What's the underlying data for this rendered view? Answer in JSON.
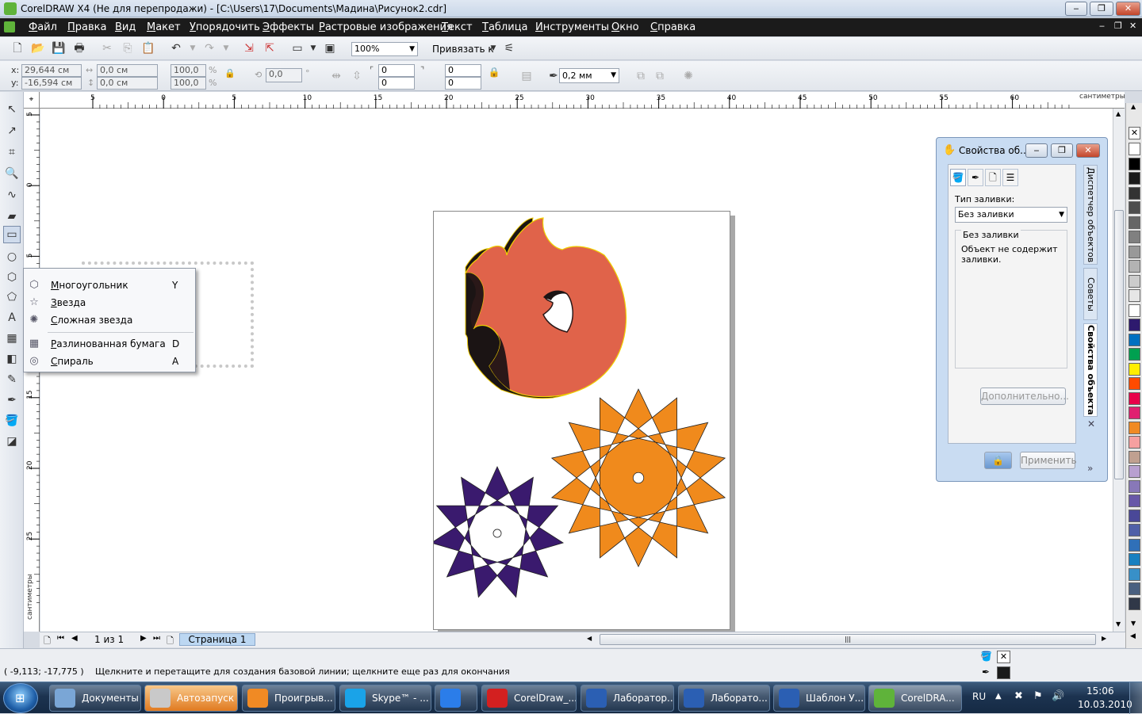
{
  "window": {
    "title": "CorelDRAW X4 (Не для перепродажи) - [C:\\Users\\17\\Documents\\Мадина\\Рисунок2.cdr]",
    "controls": {
      "minimize": "‒",
      "restore": "❐",
      "close": "✕"
    }
  },
  "menu": [
    "Файл",
    "Правка",
    "Вид",
    "Макет",
    "Упорядочить",
    "Эффекты",
    "Растровые изображения",
    "Текст",
    "Таблица",
    "Инструменты",
    "Окно",
    "Справка"
  ],
  "toolbar": {
    "zoom": "100%",
    "snap_label": "Привязать к"
  },
  "property_bar": {
    "x": "29,644 см",
    "y": "-16,594 см",
    "x_label": "x:",
    "y_label": "y:",
    "width": "0,0 см",
    "height": "0,0 см",
    "scale_x": "100,0",
    "scale_y": "100,0",
    "pct": "%",
    "angle": "0,0",
    "corner_tl": "0",
    "corner_bl": "0",
    "corner_tr": "0",
    "corner_br": "0",
    "outline_width": "0,2 мм"
  },
  "ruler": {
    "h_ticks": [
      "5",
      "0",
      "5",
      "10",
      "15",
      "20",
      "25",
      "30",
      "35",
      "40",
      "45",
      "50",
      "55",
      "60"
    ],
    "h_unit": "сантиметры",
    "v_ticks": [
      "5",
      "0",
      "5",
      "10",
      "15",
      "20",
      "25"
    ],
    "v_unit": "сантиметры"
  },
  "flyout": {
    "items": [
      {
        "label": "Многоугольник",
        "key": "Y",
        "icon": "polygon-icon"
      },
      {
        "label": "Звезда",
        "key": "",
        "icon": "star-icon"
      },
      {
        "label": "Сложная звезда",
        "key": "",
        "icon": "complex-star-icon"
      },
      {
        "label": "Разлинованная бумага",
        "key": "D",
        "icon": "graph-paper-icon"
      },
      {
        "label": "Спираль",
        "key": "A",
        "icon": "spiral-icon"
      }
    ]
  },
  "docker": {
    "title": "Свойства об...",
    "fill_type_label": "Тип заливки:",
    "fill_type_value": "Без заливки",
    "group_title": "Без заливки",
    "group_text": "Объект не содержит заливки.",
    "advanced_button": "Дополнительно...",
    "apply_button": "Применить",
    "side_tabs": [
      "Диспетчер объектов",
      "Советы",
      "Свойства объекта"
    ]
  },
  "pages": {
    "counter": "1 из 1",
    "tab": "Страница 1"
  },
  "status": {
    "coords": "( -9,113; -17,775 )",
    "hint": "Щелкните и перетащите для создания базовой линии; щелкните еще раз для окончания"
  },
  "taskbar": {
    "buttons": [
      {
        "label": "Документы",
        "icon": "folder-icon",
        "color": "#7aa6d6"
      },
      {
        "label": "Автозапуск",
        "icon": "drive-icon",
        "color": "#c9c9c9"
      },
      {
        "label": "Проигрыв...",
        "icon": "media-player-icon",
        "color": "#f08a24"
      },
      {
        "label": "Skype™ - ...",
        "icon": "skype-icon",
        "color": "#1aa3e8"
      },
      {
        "label": "",
        "icon": "ie-icon",
        "color": "#2b7de9"
      },
      {
        "label": "CorelDraw_...",
        "icon": "pdf-icon",
        "color": "#d32020"
      },
      {
        "label": "Лаборатор...",
        "icon": "word-icon",
        "color": "#2b5fb3"
      },
      {
        "label": "Лаборато...",
        "icon": "word-icon",
        "color": "#2b5fb3"
      },
      {
        "label": "Шаблон У...",
        "icon": "word-icon",
        "color": "#2b5fb3"
      },
      {
        "label": "CorelDRA...",
        "icon": "coreldraw-icon",
        "color": "#5fb33a"
      }
    ],
    "lang": "RU",
    "time": "15:06",
    "date": "10.03.2010"
  },
  "palette": [
    "#ffffff",
    "#000000",
    "#1a1a1a",
    "#333333",
    "#4d4d4d",
    "#666666",
    "#808080",
    "#999999",
    "#b3b3b3",
    "#cccccc",
    "#e6e6e6",
    "#ffffff",
    "#2e1a6e",
    "#0070c0",
    "#00a050",
    "#ffee00",
    "#ff4b00",
    "#e8004a",
    "#e02070",
    "#f08a24",
    "#f6a0a0",
    "#c0a090",
    "#b8a0d0",
    "#8878b8",
    "#6858a8",
    "#4a4898",
    "#5060a8",
    "#3070b8",
    "#1880c0",
    "#3890c8",
    "#4a6080",
    "#303848"
  ],
  "colors": {
    "gear_fill": "#e0634a",
    "gear_shadow": "#1b1414",
    "star_orange": "#f08a1c",
    "star_purple": "#3a1a6e"
  }
}
